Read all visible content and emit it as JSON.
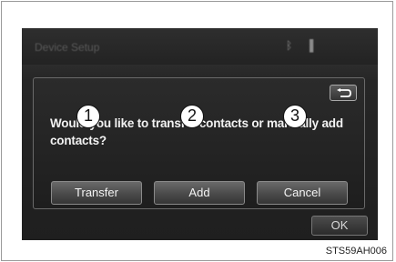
{
  "screen": {
    "title": "Device Setup",
    "status_icons": [
      "bluetooth-icon",
      "signal-icon"
    ]
  },
  "dialog": {
    "message": "Would you like to transfer contacts or manually add contacts?",
    "buttons": {
      "transfer": "Transfer",
      "add": "Add",
      "cancel": "Cancel"
    }
  },
  "callouts": [
    "1",
    "2",
    "3"
  ],
  "footer": {
    "ok_label": "OK"
  },
  "figure_code": "STS59AH006"
}
